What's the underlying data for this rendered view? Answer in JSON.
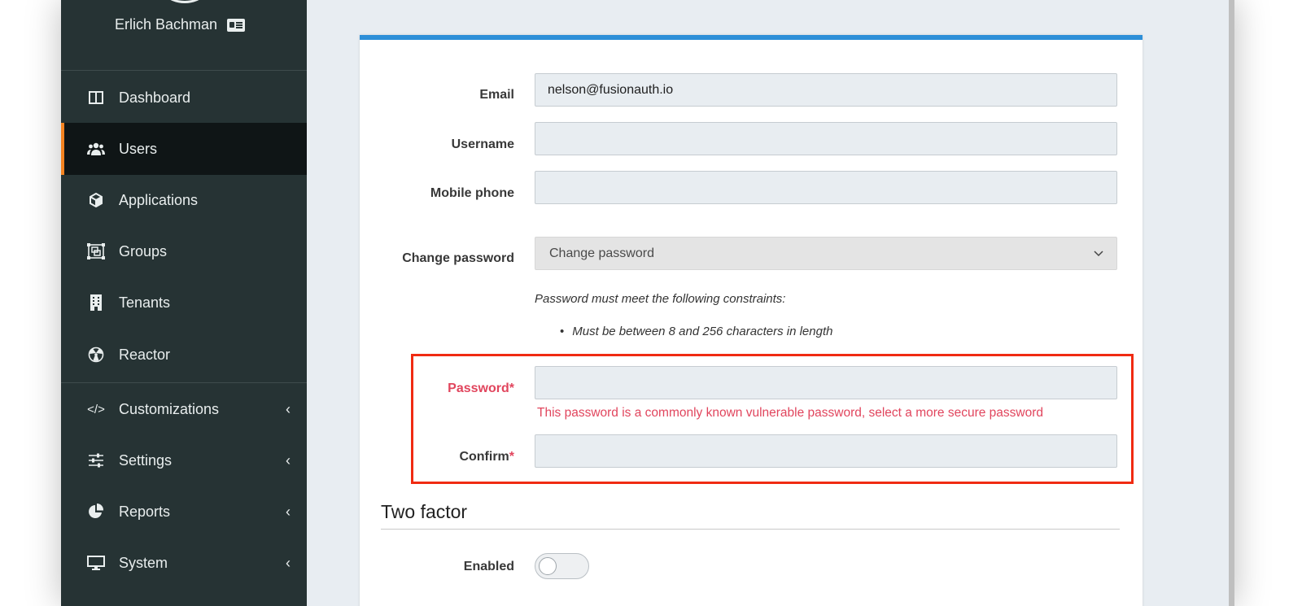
{
  "sidebar": {
    "user_name": "Erlich Bachman",
    "items": [
      {
        "label": "Dashboard",
        "icon": "columns-icon",
        "active": false,
        "chevron": ""
      },
      {
        "label": "Users",
        "icon": "users-icon",
        "active": true,
        "chevron": ""
      },
      {
        "label": "Applications",
        "icon": "cube-icon",
        "active": false,
        "chevron": ""
      },
      {
        "label": "Groups",
        "icon": "object-group-icon",
        "active": false,
        "chevron": ""
      },
      {
        "label": "Tenants",
        "icon": "building-icon",
        "active": false,
        "chevron": ""
      },
      {
        "label": "Reactor",
        "icon": "radiation-icon",
        "active": false,
        "chevron": ""
      },
      {
        "label": "Customizations",
        "icon": "code-icon",
        "active": false,
        "chevron": "‹"
      },
      {
        "label": "Settings",
        "icon": "sliders-icon",
        "active": false,
        "chevron": "‹"
      },
      {
        "label": "Reports",
        "icon": "pie-chart-icon",
        "active": false,
        "chevron": "‹"
      },
      {
        "label": "System",
        "icon": "desktop-icon",
        "active": false,
        "chevron": "‹"
      }
    ]
  },
  "form": {
    "email_label": "Email",
    "email_value": "nelson@fusionauth.io",
    "username_label": "Username",
    "username_value": "",
    "mobile_label": "Mobile phone",
    "mobile_value": "",
    "change_password_label": "Change password",
    "change_password_value": "Change password",
    "constraints_intro": "Password must meet the following constraints:",
    "constraint_1": "Must be between 8 and 256 characters in length",
    "password_label": "Password",
    "password_required": "*",
    "password_error": "This password is a commonly known vulnerable password, select a more secure password",
    "confirm_label": "Confirm",
    "confirm_required": "*"
  },
  "two_factor": {
    "title": "Two factor",
    "enabled_label": "Enabled",
    "enabled": false
  },
  "colors": {
    "sidebar_bg": "#263334",
    "active_accent": "#f58320",
    "card_top_border": "#2d8fd8",
    "error": "#e1455d",
    "highlight_box": "#f02b12"
  }
}
